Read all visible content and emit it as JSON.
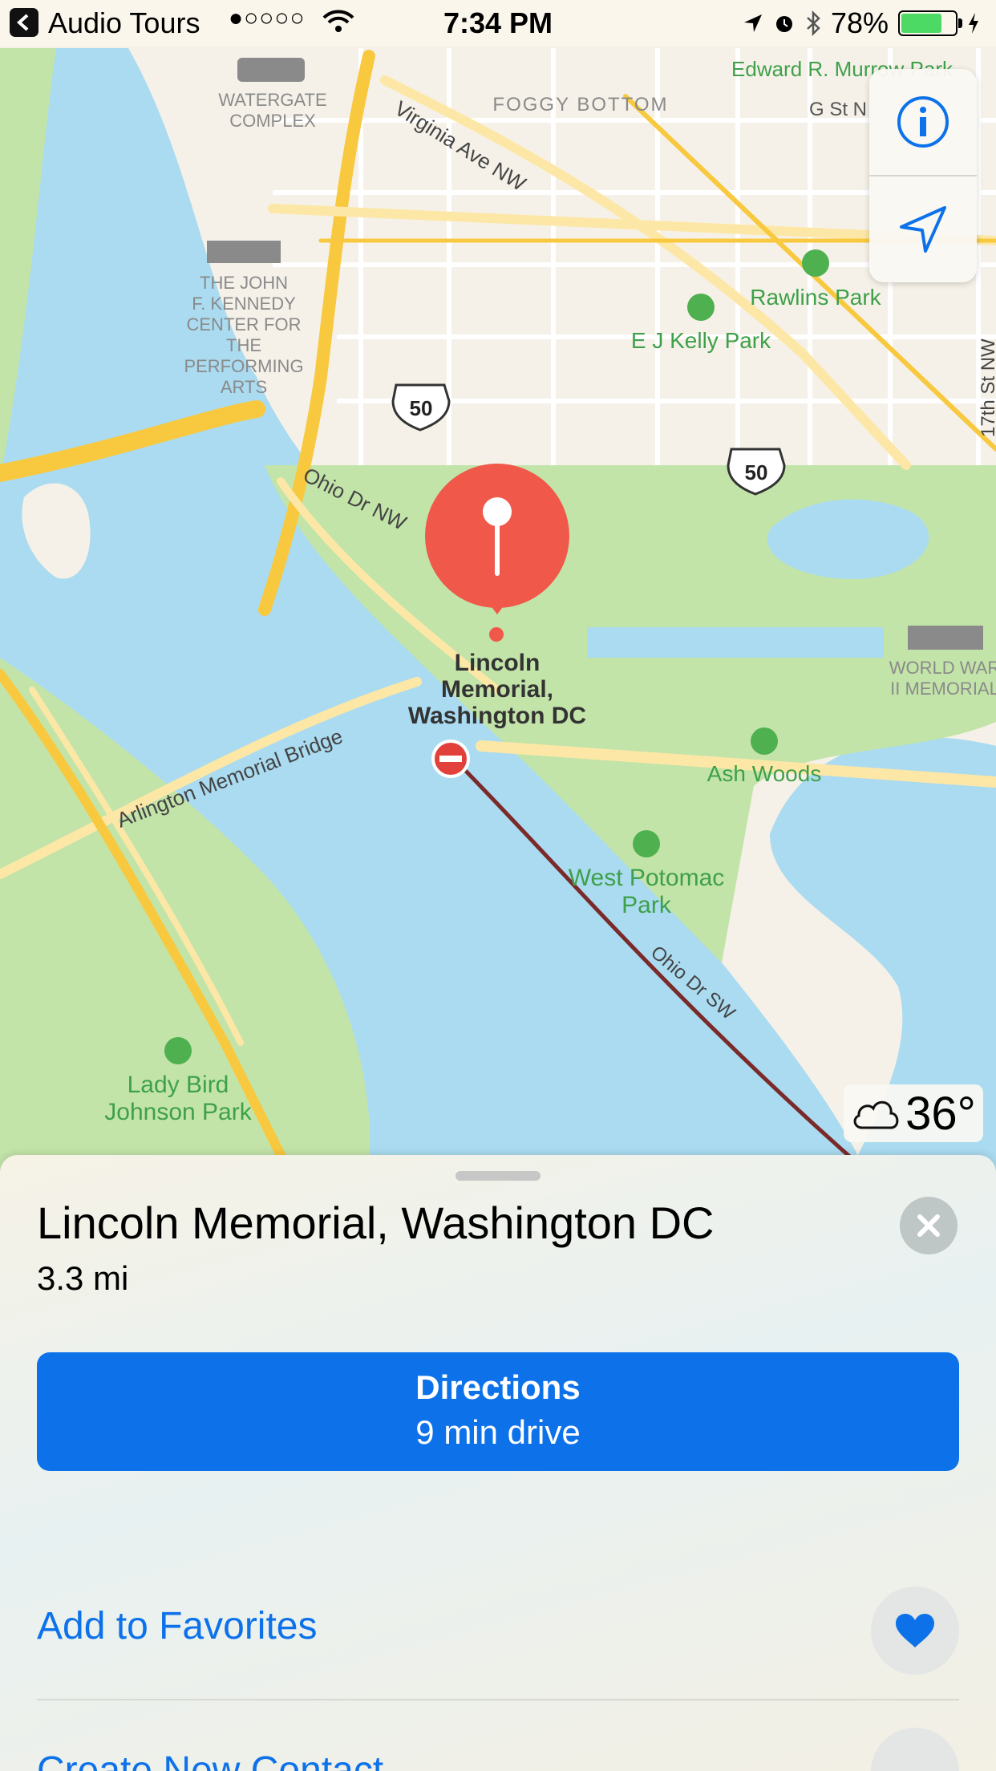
{
  "status_bar": {
    "back_app": "Audio Tours",
    "signal": "●○○○○",
    "time": "7:34 PM",
    "battery": "78%",
    "battery_level": 0.78
  },
  "map": {
    "labels": {
      "watergate": "WATERGATE COMPLEX",
      "foggy_bottom": "FOGGY BOTTOM",
      "murrow": "Edward R. Murrow Park",
      "g_st": "G St N",
      "virginia_ave": "Virginia Ave NW",
      "kennedy_center": "THE JOHN F. KENNEDY CENTER FOR THE PERFORMING ARTS",
      "rawlins_park": "Rawlins Park",
      "ej_kelly_park": "E J Kelly Park",
      "seventeenth_st": "17th St NW",
      "route_50_a": "50",
      "route_50_b": "50",
      "ohio_dr_nw": "Ohio Dr NW",
      "lincoln_line1": "Lincoln",
      "lincoln_line2": "Memorial,",
      "lincoln_line3": "Washington DC",
      "wwii_line1": "WORLD WAR",
      "wwii_line2": "II MEMORIAL",
      "ash_woods": "Ash Woods",
      "arlington_bridge": "Arlington Memorial Bridge",
      "west_potomac_1": "West Potomac",
      "west_potomac_2": "Park",
      "ohio_dr_sw": "Ohio Dr SW",
      "lady_bird_1": "Lady Bird",
      "lady_bird_2": "Johnson Park"
    },
    "weather": {
      "icon": "cloud-icon",
      "temperature": "36°"
    }
  },
  "controls": {
    "info_icon": "info-icon",
    "location_icon": "location-arrow-icon"
  },
  "place": {
    "title": "Lincoln Memorial, Washington DC",
    "distance": "3.3 mi",
    "directions_label": "Directions",
    "directions_eta": "9 min drive",
    "actions": [
      {
        "label": "Add to Favorites",
        "icon": "heart-icon"
      },
      {
        "label": "Create New Contact",
        "icon": "add-contact-icon"
      }
    ]
  },
  "colors": {
    "accent": "#0d72ea",
    "pin": "#f0584a",
    "water": "#aadbf0",
    "park": "#c3e4a9",
    "land": "#f5f1e8",
    "road": "#f8d66b"
  }
}
